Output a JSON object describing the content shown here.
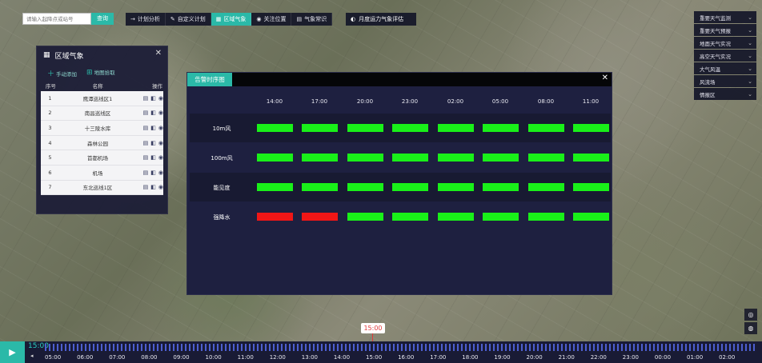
{
  "search": {
    "placeholder": "请输入起降点或站号",
    "button": "查询"
  },
  "topnav": [
    {
      "icon": "→",
      "label": "计划分析",
      "active": false
    },
    {
      "icon": "✎",
      "label": "自定义计划",
      "active": false
    },
    {
      "icon": "▦",
      "label": "区域气象",
      "active": true
    },
    {
      "icon": "◉",
      "label": "关注位置",
      "active": false
    },
    {
      "icon": "▤",
      "label": "气象常识",
      "active": false
    }
  ],
  "extra_nav": {
    "icon": "◐",
    "label": "月度运力气象评估"
  },
  "layers": [
    "重要天气监测",
    "重要天气预报",
    "地面天气实况",
    "高空天气实况",
    "大气风温",
    "风流场",
    "情报区"
  ],
  "region_panel": {
    "title": "区域气象",
    "action_add": "手动添加",
    "action_pick": "地图拾取",
    "col_index": "序号",
    "col_name": "名称",
    "col_ops": "操作",
    "rows": [
      {
        "idx": "1",
        "name": "鹰潭巡线区1"
      },
      {
        "idx": "2",
        "name": "南昌巡线区"
      },
      {
        "idx": "3",
        "name": "十三陵水库"
      },
      {
        "idx": "4",
        "name": "森林公园"
      },
      {
        "idx": "5",
        "name": "首都机场"
      },
      {
        "idx": "6",
        "name": "机场"
      },
      {
        "idx": "7",
        "name": "东北巡线1区"
      }
    ]
  },
  "alarm": {
    "title": "告警时序图",
    "times": [
      "14:00",
      "17:00",
      "20:00",
      "23:00",
      "02:00",
      "05:00",
      "08:00",
      "11:00"
    ],
    "rows": [
      {
        "label": "10m风",
        "status": [
          "ok",
          "ok",
          "ok",
          "ok",
          "ok",
          "ok",
          "ok",
          "ok"
        ]
      },
      {
        "label": "100m风",
        "status": [
          "ok",
          "ok",
          "ok",
          "ok",
          "ok",
          "ok",
          "ok",
          "ok"
        ]
      },
      {
        "label": "能见度",
        "status": [
          "ok",
          "ok",
          "ok",
          "ok",
          "ok",
          "ok",
          "ok",
          "ok"
        ]
      },
      {
        "label": "强降水",
        "status": [
          "alarm",
          "alarm",
          "ok",
          "ok",
          "ok",
          "ok",
          "ok",
          "ok"
        ]
      }
    ],
    "colors": {
      "ok": "#19f019",
      "alarm": "#f01616"
    }
  },
  "timeline": {
    "current": "15:00",
    "marker": "15:00",
    "hours": [
      "05:00",
      "06:00",
      "07:00",
      "08:00",
      "09:00",
      "10:00",
      "11:00",
      "12:00",
      "13:00",
      "14:00",
      "15:00",
      "16:00",
      "17:00",
      "18:00",
      "19:00",
      "20:00",
      "21:00",
      "22:00",
      "23:00",
      "00:00",
      "01:00",
      "02:00"
    ]
  },
  "accent": "#2bb9a8"
}
